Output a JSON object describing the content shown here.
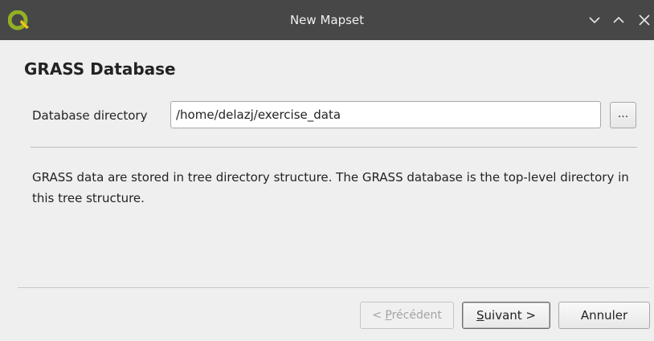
{
  "window": {
    "title": "New Mapset",
    "icons": {
      "app": "qgis-logo-icon",
      "minimize": "chevron-down-icon",
      "maximize": "chevron-up-icon",
      "close": "close-icon"
    },
    "colors": {
      "titlebar": "#474747",
      "logo_green": "#93b023",
      "logo_yellow": "#f0c418"
    }
  },
  "page": {
    "title": "GRASS Database",
    "database_directory": {
      "label": "Database directory",
      "value": "/home/delazj/exercise_data",
      "browse_label": "..."
    },
    "description": "GRASS data are stored in tree directory structure. The GRASS database is the top-level directory in this tree structure."
  },
  "buttons": {
    "previous": {
      "prefix": "< ",
      "mnemonic": "P",
      "rest": "récédent",
      "enabled": false
    },
    "next": {
      "mnemonic": "S",
      "rest": "uivant >"
    },
    "cancel": {
      "label": "Annuler"
    }
  }
}
